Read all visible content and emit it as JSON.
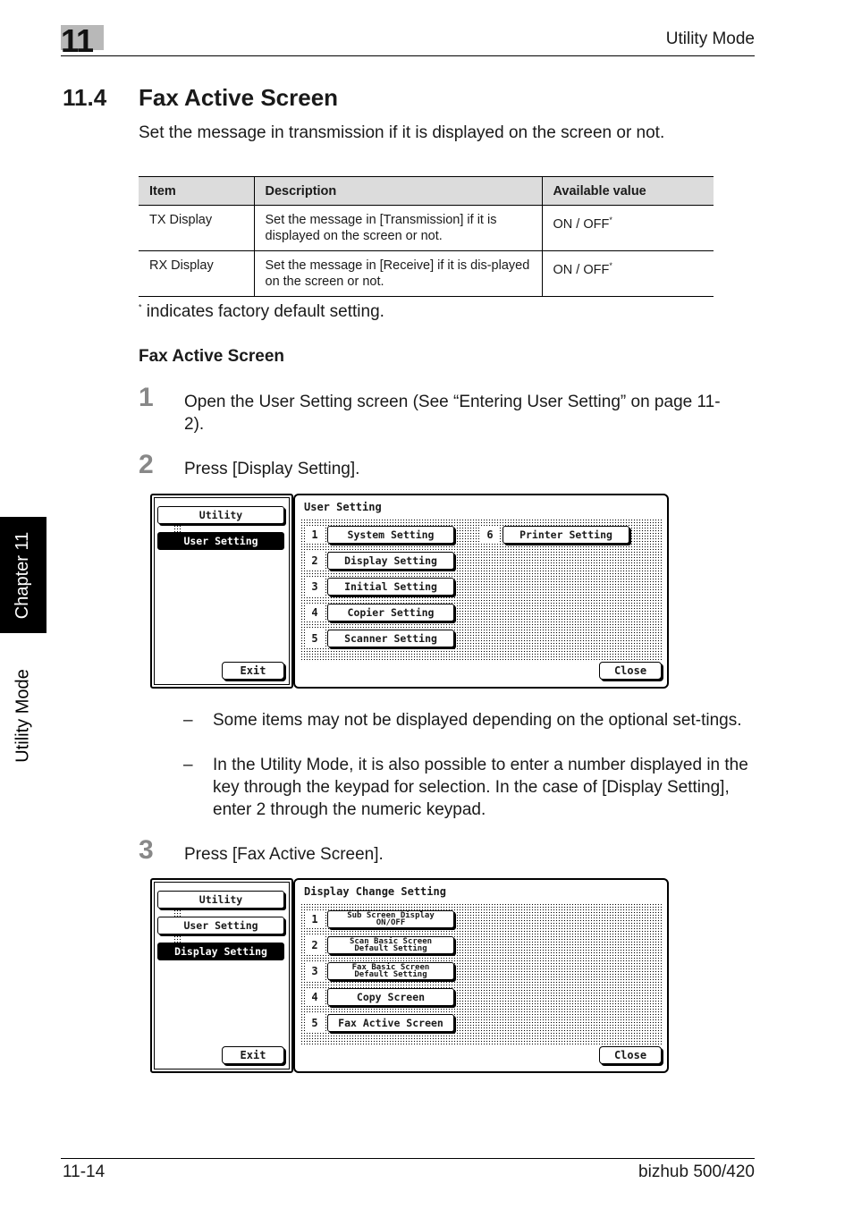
{
  "header": {
    "chapter_number": "11",
    "running_title": "Utility Mode"
  },
  "side_tab": {
    "chapter_label": "Chapter 11",
    "mode_label": "Utility Mode"
  },
  "section": {
    "number": "11.4",
    "title": "Fax Active Screen",
    "intro": "Set the message in transmission if it is displayed on the screen or not."
  },
  "table": {
    "headers": [
      "Item",
      "Description",
      "Available value"
    ],
    "rows": [
      {
        "item": "TX Display",
        "description": "Set the message in [Transmission] if it is displayed on the screen or not.",
        "value": "ON / OFF",
        "mark": "*"
      },
      {
        "item": "RX Display",
        "description": "Set the message in [Receive] if it is dis-played on the screen or not.",
        "value": "ON / OFF",
        "mark": "*"
      }
    ],
    "footnote_mark": "*",
    "footnote": " indicates factory default setting."
  },
  "subheading": "Fax Active Screen",
  "steps": [
    {
      "num": "1",
      "text": "Open the User Setting screen (See “Entering User Setting” on page 11-2)."
    },
    {
      "num": "2",
      "text": "Press [Display Setting]."
    },
    {
      "num": "3",
      "text": "Press [Fax Active Screen]."
    }
  ],
  "notes": [
    "Some items may not be displayed depending on the optional set-tings.",
    "In the Utility Mode, it is also possible to enter a number displayed in the key through the keypad for selection. In the case of [Display Setting], enter 2 through the numeric keypad."
  ],
  "note_dash": "–",
  "screen1": {
    "nav": [
      "Utility",
      "User Setting"
    ],
    "exit": "Exit",
    "title": "User Setting",
    "buttons": [
      {
        "num": "1",
        "label": "System Setting"
      },
      {
        "num": "2",
        "label": "Display Setting"
      },
      {
        "num": "3",
        "label": "Initial Setting"
      },
      {
        "num": "4",
        "label": "Copier Setting"
      },
      {
        "num": "5",
        "label": "Scanner Setting"
      },
      {
        "num": "6",
        "label": "Printer Setting"
      }
    ],
    "close": "Close"
  },
  "screen2": {
    "nav": [
      "Utility",
      "User Setting",
      "Display Setting"
    ],
    "exit": "Exit",
    "title": "Display Change Setting",
    "buttons": [
      {
        "num": "1",
        "line1": "Sub Screen Display",
        "line2": "ON/OFF"
      },
      {
        "num": "2",
        "line1": "Scan Basic Screen",
        "line2": "Default Setting"
      },
      {
        "num": "3",
        "line1": "Fax Basic Screen",
        "line2": "Default Setting"
      },
      {
        "num": "4",
        "label": "Copy Screen"
      },
      {
        "num": "5",
        "label": "Fax Active Screen"
      }
    ],
    "close": "Close"
  },
  "footer": {
    "page": "11-14",
    "product": "bizhub 500/420"
  }
}
